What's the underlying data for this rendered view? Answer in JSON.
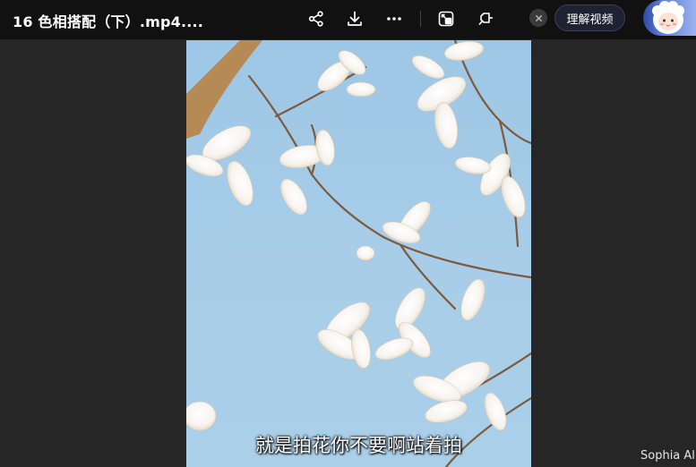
{
  "header": {
    "title": "16 色相搭配（下）.mp4....",
    "understand_video_label": "理解视频"
  },
  "toolbar": {
    "icons": [
      "share-icon",
      "download-icon",
      "more-icon",
      "picture-in-picture-icon",
      "pin-icon"
    ]
  },
  "video": {
    "subtitle": "就是拍花你不要啊站着拍",
    "watermark": "Sophia Al"
  }
}
